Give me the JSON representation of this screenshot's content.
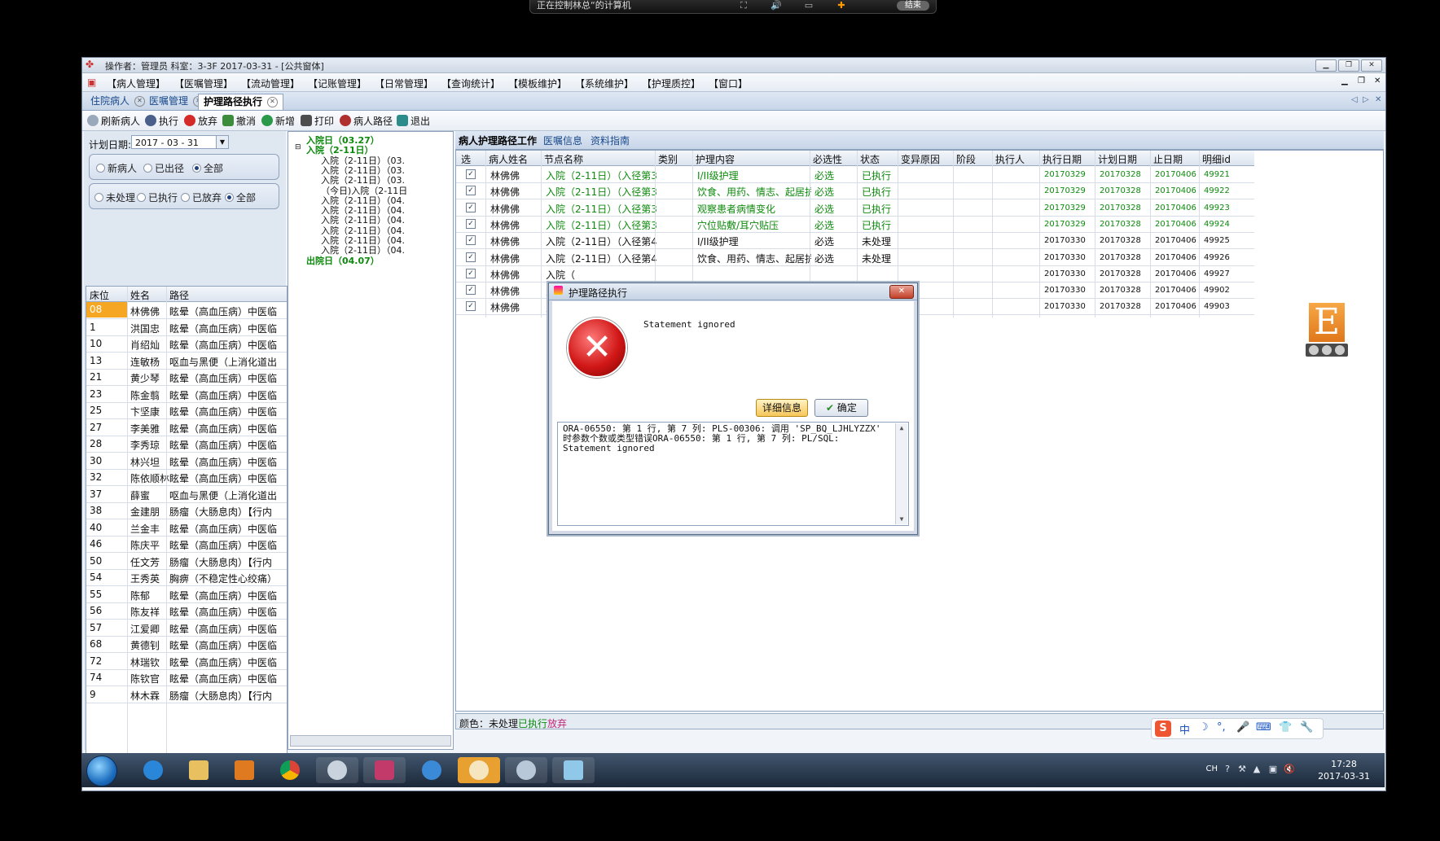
{
  "remote_bar": {
    "title": "正在控制林总“的计算机",
    "end_label": "结束"
  },
  "window": {
    "title": "操作者：管理员  科室：3-3F  2017-03-31 - [公共窗体]",
    "menu": [
      "【病人管理】",
      "【医嘱管理】",
      "【流动管理】",
      "【记账管理】",
      "【日常管理】",
      "【查询统计】",
      "【模板维护】",
      "【系统维护】",
      "【护理质控】",
      "【窗口】"
    ],
    "tabs": [
      "住院病人",
      "医嘱管理",
      "护理路径执行"
    ],
    "toolbar": [
      "刷新病人",
      "执行",
      "放弃",
      "撤消",
      "新增",
      "打印",
      "病人路径",
      "退出"
    ]
  },
  "left_panel": {
    "plan_date_label": "计划日期:",
    "plan_date": "2017 - 03 - 31",
    "filter1": [
      "新病人",
      "已出径",
      "全部"
    ],
    "filter2": [
      "未处理",
      "已执行",
      "已放弃",
      "全部"
    ],
    "columns": [
      "床位",
      "姓名",
      "路径"
    ],
    "rows": [
      [
        "08",
        "林佛佛",
        "眩晕（高血压病）中医临"
      ],
      [
        "1",
        "洪国忠",
        "眩晕（高血压病）中医临"
      ],
      [
        "10",
        "肖绍灿",
        "眩晕（高血压病）中医临"
      ],
      [
        "13",
        "连敏杨",
        "呕血与黑便（上消化道出"
      ],
      [
        "21",
        "黄少琴",
        "眩晕（高血压病）中医临"
      ],
      [
        "23",
        "陈金翦",
        "眩晕（高血压病）中医临"
      ],
      [
        "25",
        "卞坚康",
        "眩晕（高血压病）中医临"
      ],
      [
        "27",
        "李美雅",
        "眩晕（高血压病）中医临"
      ],
      [
        "28",
        "李秀琼",
        "眩晕（高血压病）中医临"
      ],
      [
        "30",
        "林兴坦",
        "眩晕（高血压病）中医临"
      ],
      [
        "32",
        "陈依顺林",
        "眩晕（高血压病）中医临"
      ],
      [
        "37",
        "薛蜜",
        "呕血与黑便（上消化道出"
      ],
      [
        "38",
        "金建朋",
        "肠瘤（大肠息肉）【行内"
      ],
      [
        "40",
        "兰金丰",
        "眩晕（高血压病）中医临"
      ],
      [
        "46",
        "陈庆平",
        "眩晕（高血压病）中医临"
      ],
      [
        "50",
        "任文芳",
        "肠瘤（大肠息肉）【行内"
      ],
      [
        "54",
        "王秀英",
        "胸痹（不稳定性心绞痛）"
      ],
      [
        "55",
        "陈郁",
        "眩晕（高血压病）中医临"
      ],
      [
        "56",
        "陈友祥",
        "眩晕（高血压病）中医临"
      ],
      [
        "57",
        "江爱卿",
        "眩晕（高血压病）中医临"
      ],
      [
        "68",
        "黄德钊",
        "眩晕（高血压病）中医临"
      ],
      [
        "72",
        "林瑞钦",
        "眩晕（高血压病）中医临"
      ],
      [
        "74",
        "陈钦官",
        "眩晕（高血压病）中医临"
      ],
      [
        "9",
        "林木霖",
        "肠瘤（大肠息肉）【行内"
      ]
    ]
  },
  "tree": {
    "nodes": [
      {
        "text": "入院日（03.27）",
        "green": true
      },
      {
        "text": "入院（2-11日）",
        "green": true
      },
      {
        "text": "入院（2-11日）（03.",
        "green": false
      },
      {
        "text": "入院（2-11日）（03.",
        "green": false
      },
      {
        "text": "入院（2-11日）（03.",
        "green": false
      },
      {
        "text": "（今日)入院（2-11日",
        "green": false
      },
      {
        "text": "入院（2-11日）（04.",
        "green": false
      },
      {
        "text": "入院（2-11日）（04.",
        "green": false
      },
      {
        "text": "入院（2-11日）（04.",
        "green": false
      },
      {
        "text": "入院（2-11日）（04.",
        "green": false
      },
      {
        "text": "入院（2-11日）（04.",
        "green": false
      },
      {
        "text": "入院（2-11日）（04.",
        "green": false
      },
      {
        "text": "出院日（04.07）",
        "green": true
      }
    ]
  },
  "main_tabs": [
    "病人护理路径工作",
    "医嘱信息",
    "资料指南"
  ],
  "work_grid": {
    "columns": [
      "选",
      "病人姓名",
      "节点名称",
      "类别",
      "护理内容",
      "必选性",
      "状态",
      "变异原因",
      "阶段",
      "执行人",
      "执行日期",
      "计划日期",
      "止日期",
      "明细id"
    ],
    "rows": [
      {
        "done": true,
        "name": "林佛佛",
        "node": "入院（2-11日）（入径第3天）",
        "content": "I/II级护理",
        "must": "必选",
        "status": "已执行",
        "exec": "20170329",
        "plan": "20170328",
        "end": "20170406",
        "id": "49921"
      },
      {
        "done": true,
        "name": "林佛佛",
        "node": "入院（2-11日）（入径第3天）",
        "content": "饮食、用药、情志、起居护理",
        "must": "必选",
        "status": "已执行",
        "exec": "20170329",
        "plan": "20170328",
        "end": "20170406",
        "id": "49922"
      },
      {
        "done": true,
        "name": "林佛佛",
        "node": "入院（2-11日）（入径第3天）",
        "content": "观察患者病情变化",
        "must": "必选",
        "status": "已执行",
        "exec": "20170329",
        "plan": "20170328",
        "end": "20170406",
        "id": "49923"
      },
      {
        "done": true,
        "name": "林佛佛",
        "node": "入院（2-11日）（入径第3天）",
        "content": "穴位贴敷/耳穴贴压",
        "must": "必选",
        "status": "已执行",
        "exec": "20170329",
        "plan": "20170328",
        "end": "20170406",
        "id": "49924"
      },
      {
        "done": false,
        "name": "林佛佛",
        "node": "入院（2-11日）（入径第4天）",
        "content": "I/II级护理",
        "must": "必选",
        "status": "未处理",
        "exec": "20170330",
        "plan": "20170328",
        "end": "20170406",
        "id": "49925"
      },
      {
        "done": false,
        "name": "林佛佛",
        "node": "入院（2-11日）（入径第4天）",
        "content": "饮食、用药、情志、起居护理",
        "must": "必选",
        "status": "未处理",
        "exec": "20170330",
        "plan": "20170328",
        "end": "20170406",
        "id": "49926"
      },
      {
        "done": false,
        "name": "林佛佛",
        "node": "入院（",
        "content": "",
        "must": "",
        "status": "",
        "exec": "20170330",
        "plan": "20170328",
        "end": "20170406",
        "id": "49927"
      },
      {
        "done": false,
        "name": "林佛佛",
        "node": "入院（",
        "content": "",
        "must": "",
        "status": "",
        "exec": "20170330",
        "plan": "20170328",
        "end": "20170406",
        "id": "49902"
      },
      {
        "done": false,
        "name": "林佛佛",
        "node": "入院（",
        "content": "",
        "must": "",
        "status": "",
        "exec": "20170330",
        "plan": "20170328",
        "end": "20170406",
        "id": "49903"
      }
    ]
  },
  "legend": {
    "label": "颜色：",
    "pending": "未处理",
    "done": "已执行",
    "abandoned": "放弃"
  },
  "dialog": {
    "title": "护理路径执行",
    "message": "Statement ignored",
    "detail_button": "详细信息",
    "ok_button": "确定",
    "detail": "ORA-06550: 第 1 行, 第 7 列: PLS-00306: 调用 'SP_BQ_LJHLYZZX' 时参数个数或类型错误ORA-06550: 第 1 行, 第 7 列: PL/SQL: Statement ignored"
  },
  "taskbar": {
    "tray_lang": "CH",
    "time": "17:28",
    "date": "2017-03-31"
  },
  "e_widget": {
    "letter": "E"
  },
  "ime": {
    "symbols": [
      "中",
      "☽",
      "°,",
      "🎤",
      "⌨",
      "👕",
      "🔧"
    ]
  },
  "colors": {
    "done_green": "#0d8a0d",
    "abandon_red": "#c0287a",
    "highlight_orange": "#f5a623",
    "tree_green": "#0d8a0d"
  }
}
